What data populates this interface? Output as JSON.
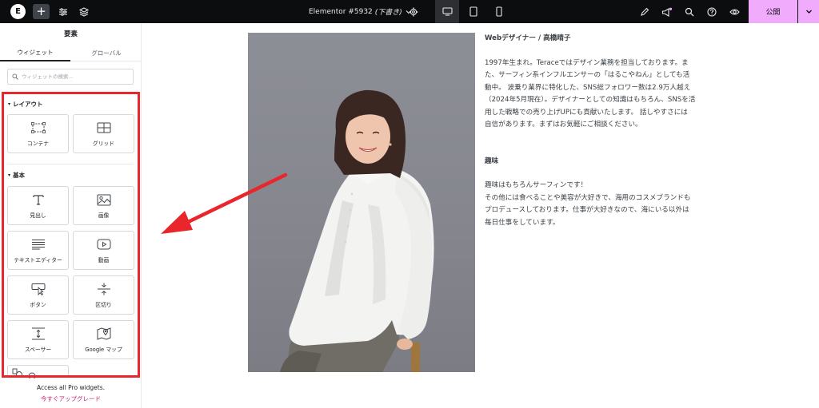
{
  "topbar": {
    "logo_letter": "E",
    "add_label": "+",
    "doc_title": "Elementor #5932",
    "doc_status": "(下書き)",
    "publish_label": "公開"
  },
  "sidebar": {
    "title": "要素",
    "tabs": [
      {
        "label": "ウィジェット",
        "active": true
      },
      {
        "label": "グローバル",
        "active": false
      }
    ],
    "search_placeholder": "ウィジェットの検索...",
    "categories": [
      {
        "title": "レイアウト",
        "widgets": [
          {
            "label": "コンテナ",
            "icon": "container-icon"
          },
          {
            "label": "グリッド",
            "icon": "grid-icon"
          }
        ]
      },
      {
        "title": "基本",
        "widgets": [
          {
            "label": "見出し",
            "icon": "heading-icon"
          },
          {
            "label": "画像",
            "icon": "image-icon"
          },
          {
            "label": "テキストエディター",
            "icon": "text-editor-icon"
          },
          {
            "label": "動画",
            "icon": "video-icon"
          },
          {
            "label": "ボタン",
            "icon": "button-icon"
          },
          {
            "label": "区切り",
            "icon": "divider-icon"
          },
          {
            "label": "スペーサー",
            "icon": "spacer-icon"
          },
          {
            "label": "Google マップ",
            "icon": "map-icon"
          }
        ]
      }
    ],
    "pro_text": "Access all Pro widgets.",
    "upgrade_text": "今すぐアップグレード"
  },
  "content": {
    "heading": "Webデザイナー / 高橋晴子",
    "bio_lines": [
      "1997年生まれ。Teraceではデザイン業務を担当しております。ま",
      "た、サーフィン系インフルエンサーの「はるこやねん」としても活",
      "動中。 波乗り業界に特化した、SNS総フォロワー数は2.9万人越え",
      "（2024年5月現在）。デザイナーとしての知識はもちろん、SNSを活",
      "用した戦略での売り上げUPにも貢献いたします。 話しやすさには",
      "自信があります。まずはお気軽にご相談ください。"
    ],
    "hobby_heading": "趣味",
    "hobby_lines": [
      "趣味はもちろんサーフィンです！",
      "その他には食べることや美容が大好きで、海用のコスメブランドも",
      "プロデュースしております。仕事が大好きなので、海にいる以外は",
      "毎日仕事をしています。"
    ]
  },
  "colors": {
    "topbar_bg": "#0c0d0e",
    "publish_bg": "#f0abfc",
    "highlight_red": "#e8262b",
    "upgrade_link": "#c0246c"
  }
}
